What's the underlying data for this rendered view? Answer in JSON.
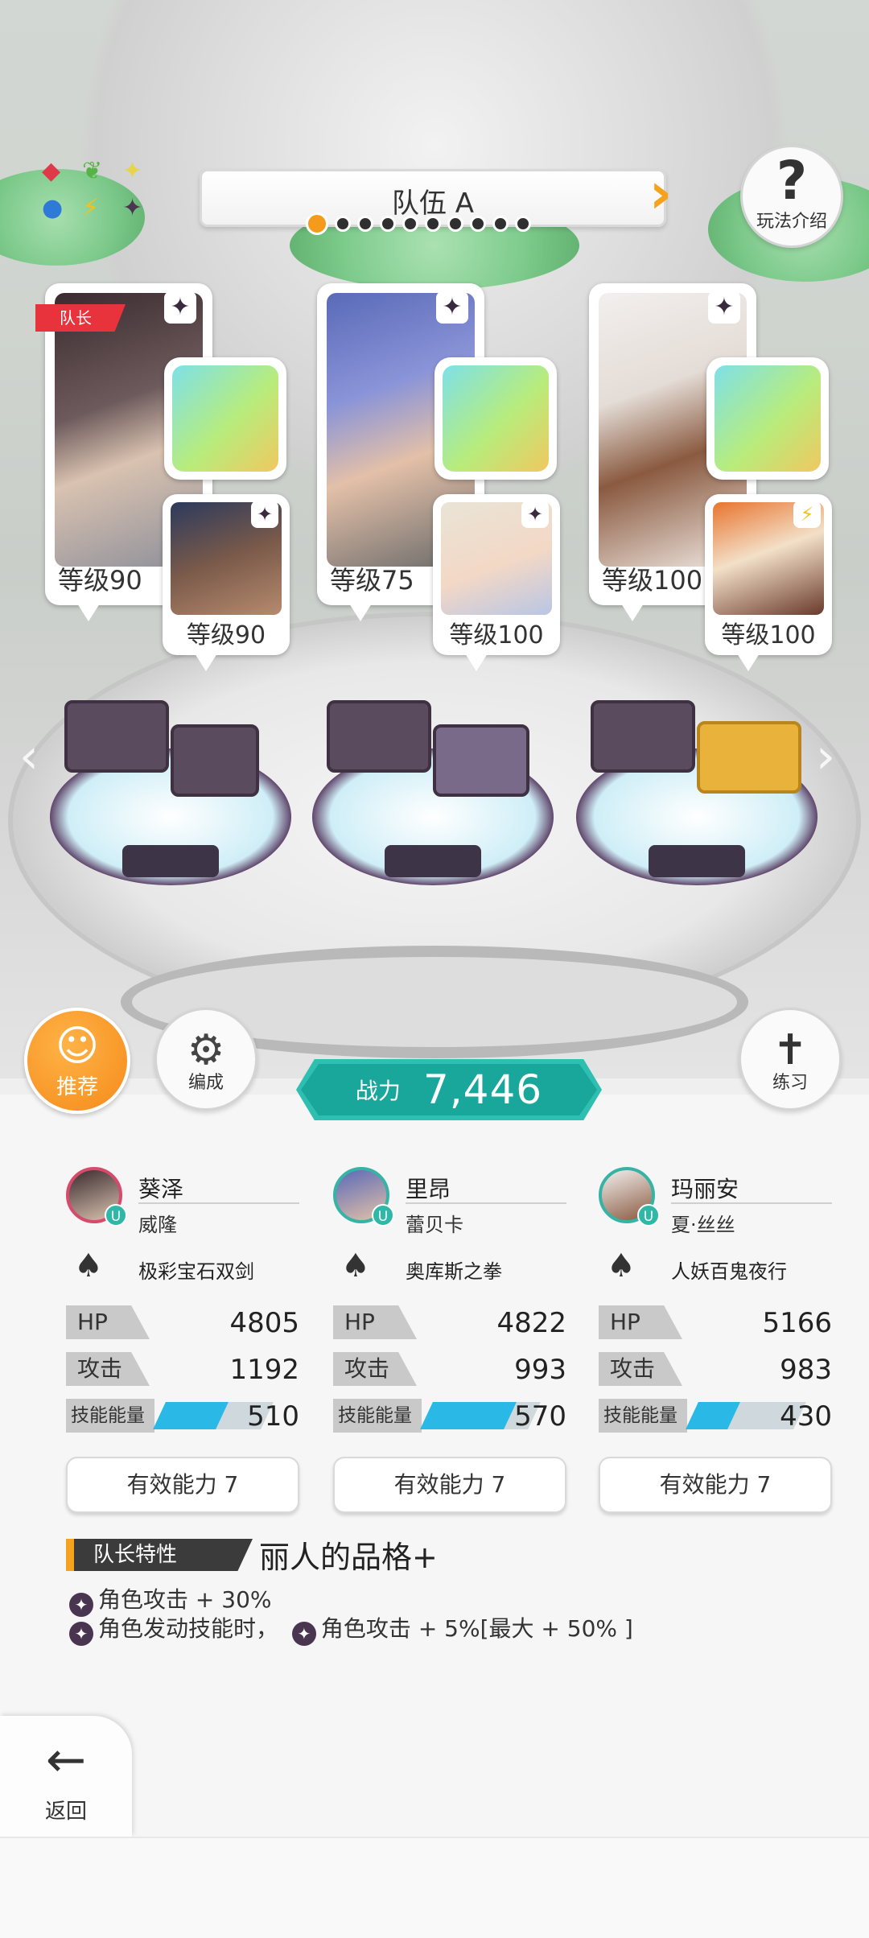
{
  "header": {
    "team_name": "队伍 A",
    "page_dots": 10,
    "active_dot": 0,
    "help_label": "玩法介绍"
  },
  "elements": {
    "icons": [
      "fire-diamond-icon",
      "leaf-icon",
      "sparkle-icon",
      "water-orb-icon",
      "lightning-icon",
      "dark-star-icon"
    ]
  },
  "slots": [
    {
      "leader_tag": "队长",
      "main_level": "等级90",
      "support_level": "等级90"
    },
    {
      "main_level": "等级75",
      "support_level": "等级100"
    },
    {
      "main_level": "等级100",
      "support_level": "等级100"
    }
  ],
  "buttons": {
    "recommend": "推荐",
    "formation": "编成",
    "practice": "练习",
    "back": "返回"
  },
  "power": {
    "label": "战力",
    "value": "7,446"
  },
  "stats_labels": {
    "hp": "HP",
    "attack": "攻击",
    "energy": "技能能量"
  },
  "members": [
    {
      "name": "葵泽",
      "support": "威隆",
      "weapon": "极彩宝石双剑",
      "hp": "4805",
      "attack": "1192",
      "energy": "510",
      "energy_fill": 0.6,
      "ability": "有效能力 7"
    },
    {
      "name": "里昂",
      "support": "蕾贝卡",
      "weapon": "奥库斯之拳",
      "hp": "4822",
      "attack": "993",
      "energy": "570",
      "energy_fill": 0.8,
      "ability": "有效能力 7"
    },
    {
      "name": "玛丽安",
      "support": "夏·丝丝",
      "weapon": "人妖百鬼夜行",
      "hp": "5166",
      "attack": "983",
      "energy": "430",
      "energy_fill": 0.4,
      "ability": "有效能力 7"
    }
  ],
  "leader_trait": {
    "tag": "队长特性",
    "title": "丽人的品格+",
    "line1": "角色攻击 + 30%",
    "line2_a": "角色发动技能时，",
    "line2_b": "角色攻击 + 5%[最大 + 50% ]"
  },
  "colors": {
    "accent_orange": "#f5a21c",
    "power_teal": "#1aa79b",
    "energy_blue": "#2ab9e6",
    "leader_red": "#e8323c"
  }
}
